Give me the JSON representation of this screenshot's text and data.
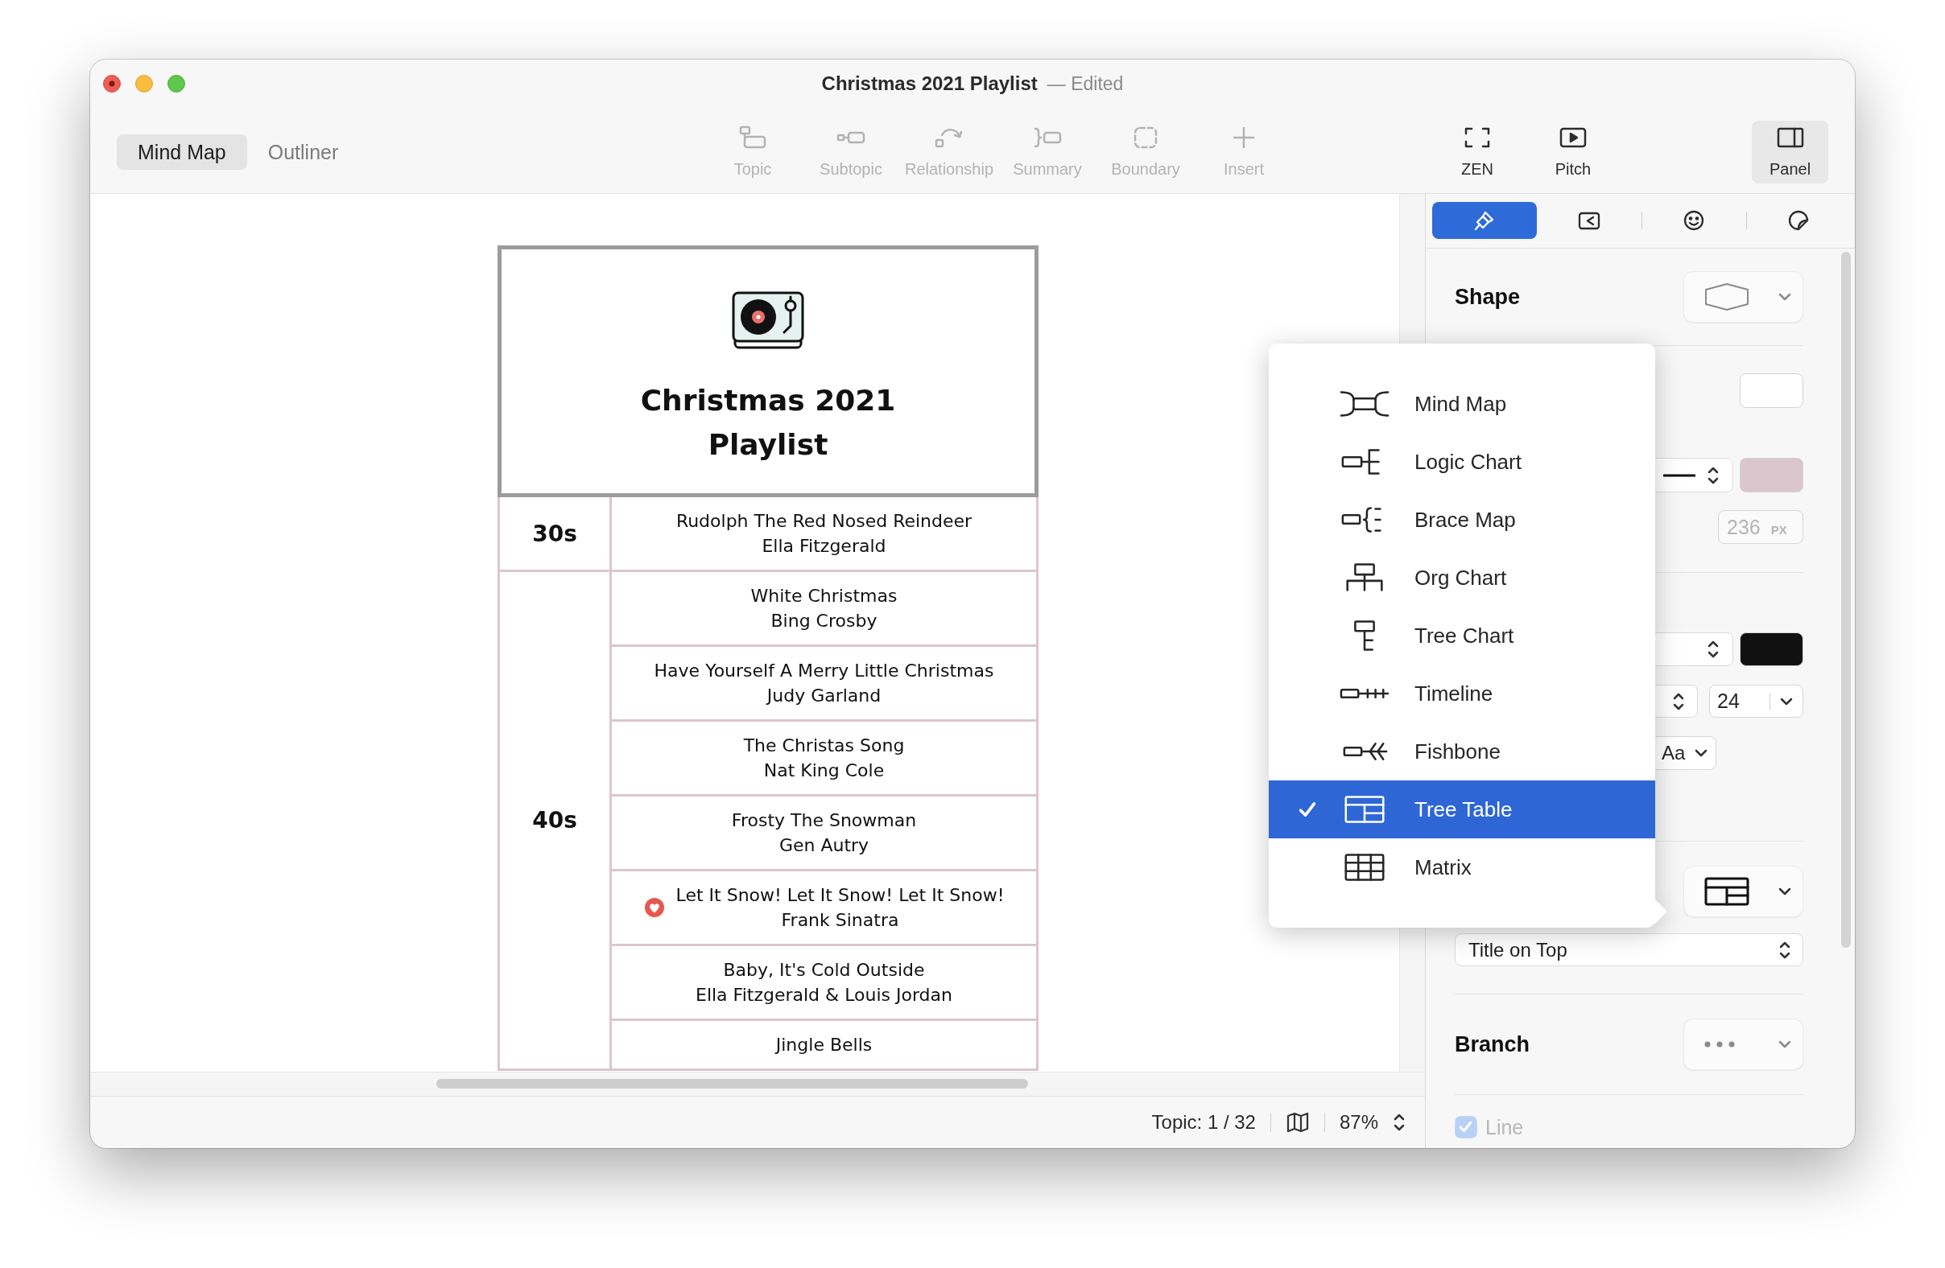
{
  "window": {
    "title": "Christmas 2021 Playlist",
    "edited_note": "— Edited"
  },
  "toolbar": {
    "view_modes": [
      {
        "label": "Mind Map",
        "selected": true
      },
      {
        "label": "Outliner",
        "selected": false
      }
    ],
    "insert_tools": [
      {
        "label": "Topic",
        "disabled": true
      },
      {
        "label": "Subtopic",
        "disabled": true
      },
      {
        "label": "Relationship",
        "disabled": true
      },
      {
        "label": "Summary",
        "disabled": true
      },
      {
        "label": "Boundary",
        "disabled": true
      },
      {
        "label": "Insert",
        "disabled": true
      }
    ],
    "view_tools": [
      {
        "label": "ZEN",
        "on": false
      },
      {
        "label": "Pitch",
        "on": false
      },
      {
        "label": "Panel",
        "on": true
      }
    ]
  },
  "tree_table": {
    "title": "Christmas 2021 Playlist",
    "groups": [
      {
        "label": "30s",
        "songs": [
          {
            "title": "Rudolph The Red Nosed Reindeer",
            "artist": "Ella Fitzgerald",
            "marker": false
          }
        ]
      },
      {
        "label": "40s",
        "songs": [
          {
            "title": "White Christmas",
            "artist": "Bing Crosby",
            "marker": false
          },
          {
            "title": "Have Yourself A Merry Little Christmas",
            "artist": "Judy Garland",
            "marker": false
          },
          {
            "title": "The Christas Song",
            "artist": "Nat King Cole",
            "marker": false
          },
          {
            "title": "Frosty The Snowman",
            "artist": "Gen Autry",
            "marker": false
          },
          {
            "title": "Let It Snow! Let It Snow! Let It Snow!",
            "artist": "Frank Sinatra",
            "marker": true
          },
          {
            "title": "Baby, It's Cold Outside",
            "artist": "Ella Fitzgerald & Louis Jordan",
            "marker": false
          },
          {
            "title": "Jingle Bells",
            "marker": false
          }
        ]
      }
    ]
  },
  "status_bar": {
    "topic_count": "Topic: 1 / 32",
    "zoom": "87%"
  },
  "format_panel": {
    "tabs": [
      {
        "selected": true
      },
      {
        "selected": false
      },
      {
        "selected": false
      },
      {
        "selected": false
      }
    ],
    "shape": {
      "title": "Shape",
      "fill_swatch": {
        "color": "#ffffff"
      },
      "line_swatch": {
        "color": "#dcc6cd"
      },
      "size_field": {
        "value": "236",
        "unit": "PX",
        "disabled": true
      }
    },
    "text": {
      "color_swatch": {
        "color": "#111111"
      },
      "size_field": {
        "value": "24"
      },
      "case_menu": {
        "value": "Aa"
      }
    },
    "structure": {
      "layout_select": {
        "value": "Title on Top"
      }
    },
    "branch": {
      "title": "Branch",
      "line_checkbox": {
        "label": "Line",
        "checked": true,
        "disabled": true
      }
    }
  },
  "structure_menu": {
    "items": [
      {
        "label": "Mind Map",
        "selected": false
      },
      {
        "label": "Logic Chart",
        "selected": false
      },
      {
        "label": "Brace Map",
        "selected": false
      },
      {
        "label": "Org Chart",
        "selected": false
      },
      {
        "label": "Tree Chart",
        "selected": false
      },
      {
        "label": "Timeline",
        "selected": false
      },
      {
        "label": "Fishbone",
        "selected": false
      },
      {
        "label": "Tree Table",
        "selected": true
      },
      {
        "label": "Matrix",
        "selected": false
      }
    ]
  }
}
